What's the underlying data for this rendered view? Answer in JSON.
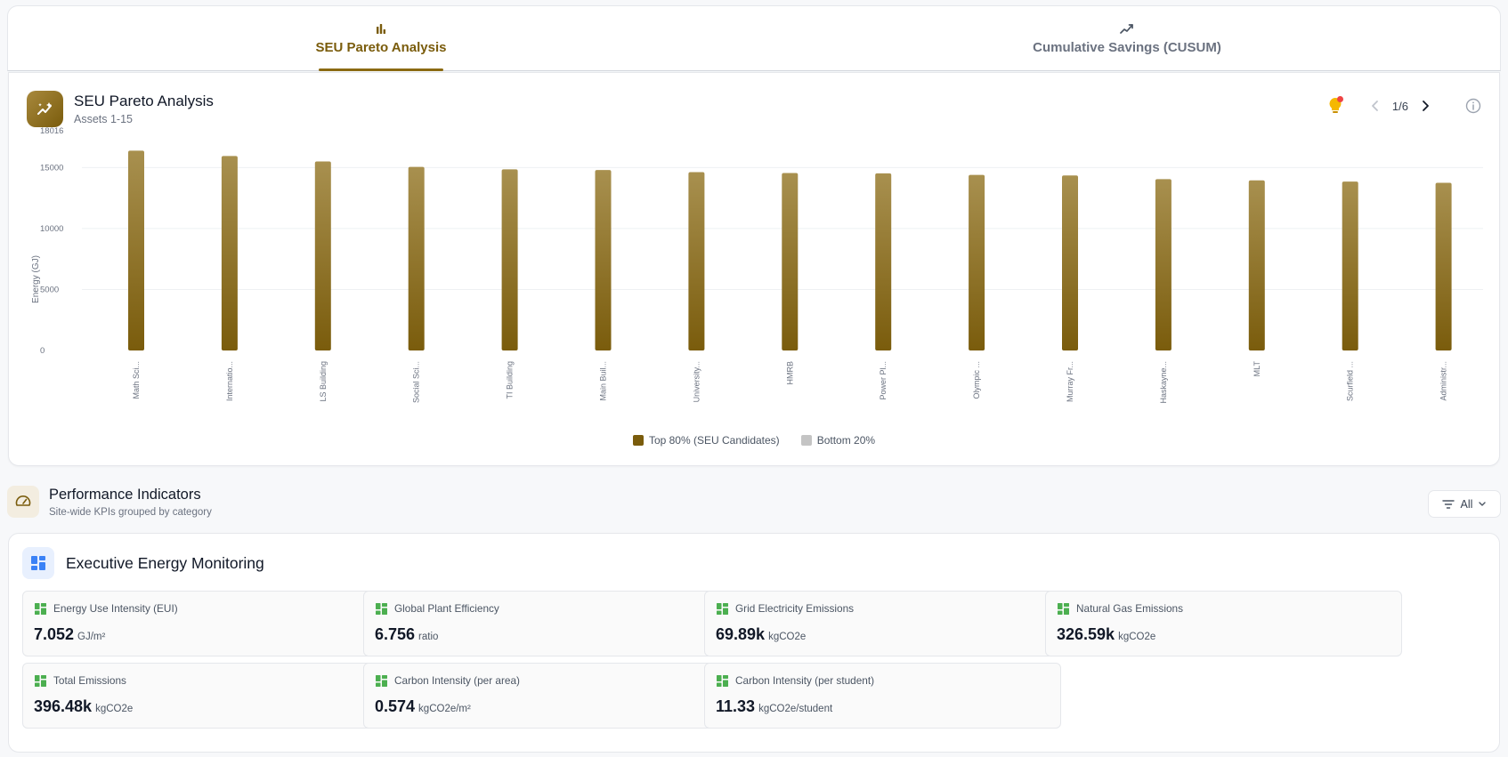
{
  "tabs": [
    {
      "label": "SEU Pareto Analysis",
      "icon": "bar-chart-icon",
      "active": true
    },
    {
      "label": "Cumulative Savings (CUSUM)",
      "icon": "trend-line-icon",
      "active": false
    }
  ],
  "chart_card": {
    "title": "SEU Pareto Analysis",
    "subtitle": "Assets 1-15",
    "pager": "1/6"
  },
  "chart_data": {
    "type": "bar",
    "ylabel": "Energy (GJ)",
    "xlabel": "",
    "ylim": [
      0,
      18016
    ],
    "yticks": [
      0,
      5000,
      10000,
      15000,
      18016
    ],
    "grid": true,
    "legend_position": "bottom",
    "categories": [
      "Math Sci...",
      "Internatio...",
      "LS Building",
      "Social Sci...",
      "TI Building",
      "Main Buil...",
      "University...",
      "HMRB",
      "Power Pl...",
      "Olympic ...",
      "Murray Fr...",
      "Haskayne...",
      "MLT",
      "Scurfield ...",
      "Administr..."
    ],
    "series": [
      {
        "name": "Top 80% (SEU Candidates)",
        "values": [
          16380,
          15950,
          15500,
          15050,
          14850,
          14800,
          14620,
          14550,
          14520,
          14400,
          14350,
          14050,
          13950,
          13850,
          13750
        ]
      }
    ],
    "legend": [
      {
        "label": "Top 80% (SEU Candidates)",
        "color": "#7a5c0c"
      },
      {
        "label": "Bottom 20%",
        "color": "#c4c4c4"
      }
    ]
  },
  "performance": {
    "title": "Performance Indicators",
    "subtitle": "Site-wide KPIs grouped by category",
    "filter_label": "All"
  },
  "monitoring": {
    "title": "Executive Energy Monitoring",
    "kpis": [
      {
        "label": "Energy Use Intensity (EUI)",
        "value": "7.052",
        "unit": "GJ/m²"
      },
      {
        "label": "Global Plant Efficiency",
        "value": "6.756",
        "unit": "ratio"
      },
      {
        "label": "Grid Electricity Emissions",
        "value": "69.89k",
        "unit": "kgCO2e"
      },
      {
        "label": "Natural Gas Emissions",
        "value": "326.59k",
        "unit": "kgCO2e"
      },
      {
        "label": "Total Emissions",
        "value": "396.48k",
        "unit": "kgCO2e"
      },
      {
        "label": "Carbon Intensity (per area)",
        "value": "0.574",
        "unit": "kgCO2e/m²"
      },
      {
        "label": "Carbon Intensity (per student)",
        "value": "11.33",
        "unit": "kgCO2e/student"
      }
    ]
  },
  "colors": {
    "accent": "#7a5c0c",
    "bar_top": "#a8904f",
    "bar_bottom": "#7a5c0c",
    "kpi_icon": "#4caf50",
    "monitor_icon": "#3b82f6",
    "alert_dot": "#ef4444",
    "bulb": "#f5b800"
  }
}
